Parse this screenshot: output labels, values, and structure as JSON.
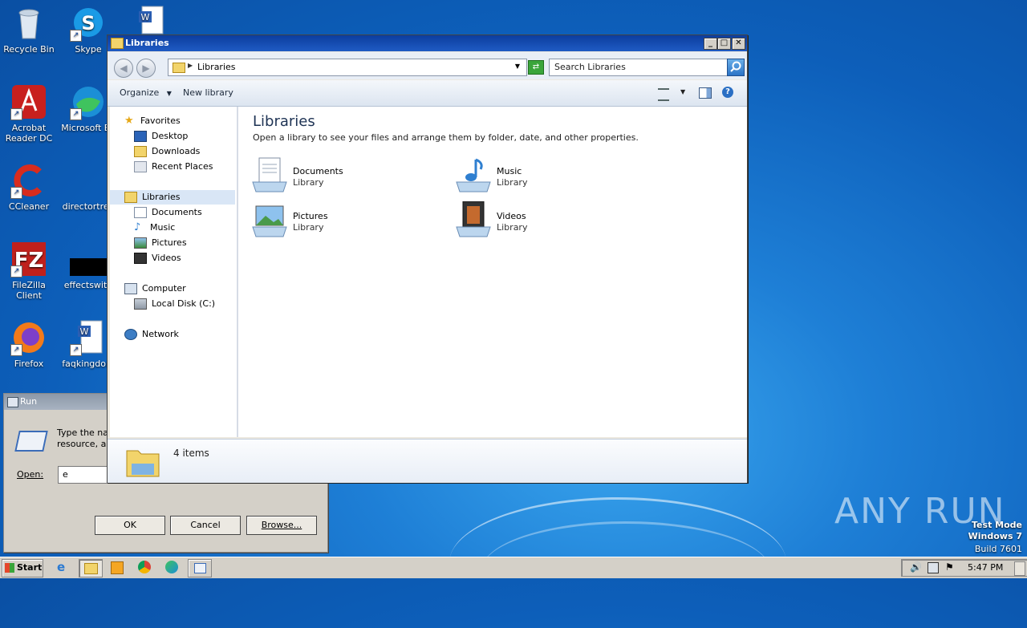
{
  "desktop": {
    "icons": [
      {
        "label": "Recycle Bin",
        "icon": "recycle-bin-icon"
      },
      {
        "label": "Skype",
        "icon": "skype-icon"
      },
      {
        "label": "Acrobat Reader DC",
        "icon": "acrobat-icon"
      },
      {
        "label": "Microsoft Ed",
        "icon": "edge-icon"
      },
      {
        "label": "CCleaner",
        "icon": "ccleaner-icon"
      },
      {
        "label": "directortrea",
        "icon": "blank-file-icon"
      },
      {
        "label": "FileZilla Client",
        "icon": "filezilla-icon"
      },
      {
        "label": "effectswith",
        "icon": "black-image-icon"
      },
      {
        "label": "Firefox",
        "icon": "firefox-icon"
      },
      {
        "label": "faqkingdom",
        "icon": "word-doc-icon"
      }
    ]
  },
  "run_dialog": {
    "title": "Run",
    "description_line1": "Type the na",
    "description_line2": "resource, ar",
    "open_label": "Open:",
    "open_value": "e",
    "ok_label": "OK",
    "cancel_label": "Cancel",
    "browse_label": "Browse..."
  },
  "explorer": {
    "title": "Libraries",
    "address": "Libraries",
    "search_placeholder": "Search Libraries",
    "toolbar": {
      "organize": "Organize",
      "new_library": "New library"
    },
    "nav": {
      "favorites": "Favorites",
      "desktop": "Desktop",
      "downloads": "Downloads",
      "recent": "Recent Places",
      "libraries": "Libraries",
      "documents": "Documents",
      "music": "Music",
      "pictures": "Pictures",
      "videos": "Videos",
      "computer": "Computer",
      "local_disk": "Local Disk (C:)",
      "network": "Network"
    },
    "content": {
      "heading": "Libraries",
      "description": "Open a library to see your files and arrange them by folder, date, and other properties.",
      "libraries": [
        {
          "name": "Documents",
          "type": "Library"
        },
        {
          "name": "Music",
          "type": "Library"
        },
        {
          "name": "Pictures",
          "type": "Library"
        },
        {
          "name": "Videos",
          "type": "Library"
        }
      ]
    },
    "details": {
      "count": "4 items"
    }
  },
  "taskbar": {
    "start": "Start",
    "clock": "5:47 PM"
  },
  "watermark": {
    "brand": "ANY RUN",
    "line1": "Test Mode",
    "line2": "Windows 7",
    "line3": "Build 7601"
  }
}
